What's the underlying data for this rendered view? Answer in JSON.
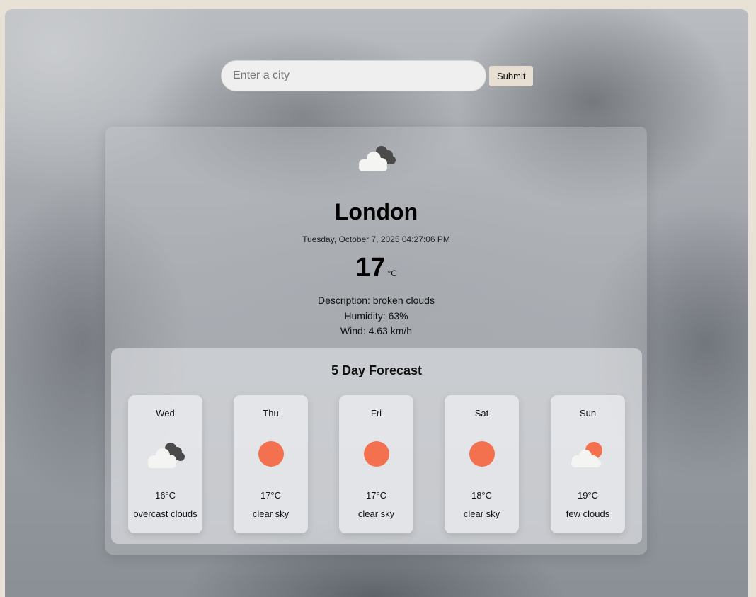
{
  "search": {
    "placeholder": "Enter a city",
    "value": "",
    "submit_label": "Submit"
  },
  "current": {
    "icon": "broken-clouds-icon",
    "city": "London",
    "datetime": "Tuesday, October 7, 2025 04:27:06 PM",
    "temperature": "17",
    "unit": "°C",
    "description": "Description: broken clouds",
    "humidity": "Humidity: 63%",
    "wind": "Wind: 4.63 km/h"
  },
  "forecast": {
    "title": "5 Day Forecast",
    "days": [
      {
        "day": "Wed",
        "temp": "16°C",
        "desc": "overcast clouds",
        "icon": "overcast-clouds-icon"
      },
      {
        "day": "Thu",
        "temp": "17°C",
        "desc": "clear sky",
        "icon": "clear-sky-icon"
      },
      {
        "day": "Fri",
        "temp": "17°C",
        "desc": "clear sky",
        "icon": "clear-sky-icon"
      },
      {
        "day": "Sat",
        "temp": "18°C",
        "desc": "clear sky",
        "icon": "clear-sky-icon"
      },
      {
        "day": "Sun",
        "temp": "19°C",
        "desc": "few clouds",
        "icon": "few-clouds-icon"
      }
    ]
  },
  "colors": {
    "sun": "#f4714f",
    "cloud_dark": "#4a4a4a",
    "cloud_light": "#f4f4f2",
    "button_bg": "#e6dfd2"
  }
}
